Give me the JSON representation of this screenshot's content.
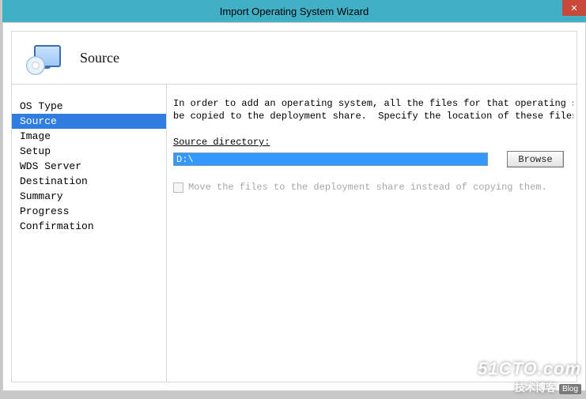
{
  "title_bar": {
    "title": "Import Operating System Wizard"
  },
  "header": {
    "title": "Source"
  },
  "nav": {
    "items": [
      {
        "label": "OS Type",
        "selected": false
      },
      {
        "label": "Source",
        "selected": true
      },
      {
        "label": "Image",
        "selected": false
      },
      {
        "label": "Setup",
        "selected": false
      },
      {
        "label": "WDS Server",
        "selected": false
      },
      {
        "label": "Destination",
        "selected": false
      },
      {
        "label": "Summary",
        "selected": false
      },
      {
        "label": "Progress",
        "selected": false
      },
      {
        "label": "Confirmation",
        "selected": false
      }
    ]
  },
  "content": {
    "description": "In order to add an operating system, all the files for that operating system need to\nbe copied to the deployment share.  Specify the location of these files (typically a",
    "source_dir_label": "Source directory:",
    "source_dir_value": "D:\\",
    "browse_label": "Browse",
    "move_checkbox_label": "Move the files to the deployment share instead of copying them.",
    "move_checked": false,
    "move_enabled": false
  },
  "watermark": {
    "line1": "51CTO.com",
    "line2": "技术博客",
    "badge": "Blog"
  }
}
